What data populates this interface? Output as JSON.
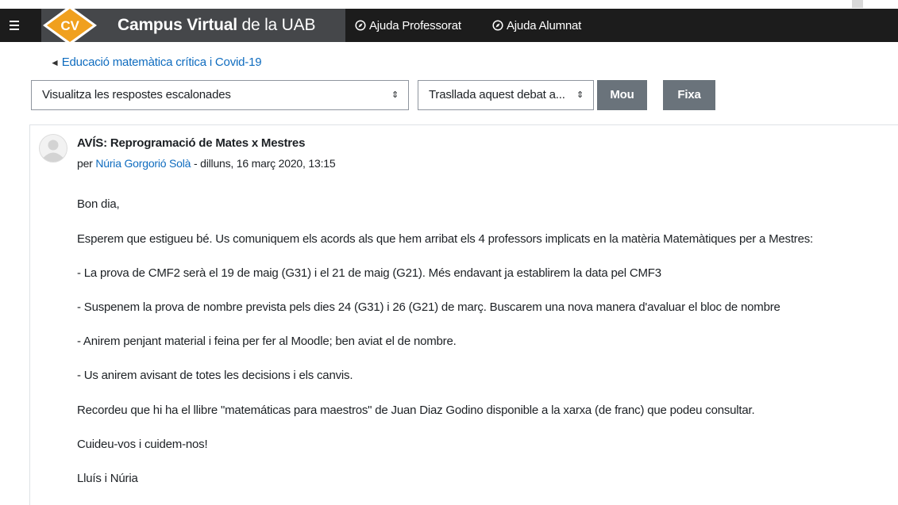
{
  "header": {
    "brand_bold": "Campus Virtual",
    "brand_rest": " de la UAB",
    "help_links": [
      "Ajuda Professorat",
      "Ajuda Alumnat"
    ]
  },
  "breadcrumb": {
    "back_label": "Educació matemàtica crítica i Covid-19"
  },
  "controls": {
    "display_mode": "Visualitza les respostes escalonades",
    "move_to": "Trasllada aquest debat a...",
    "move_button": "Mou",
    "pin_button": "Fixa"
  },
  "post": {
    "subject": "AVÍS: Reprogramació de Mates x Mestres",
    "by_prefix": "per",
    "author": "Núria Gorgorió Solà",
    "date": "- dilluns, 16 març 2020, 13:15",
    "paragraphs": [
      "Bon dia,",
      "Esperem que estigueu bé. Us comuniquem els  acords als que hem arribat els 4 professors implicats en la matèria Matemàtiques per a Mestres:",
      "- La prova de CMF2 serà el 19 de maig (G31)  i el 21 de maig (G21).  Més endavant ja establirem la data pel CMF3",
      "- Suspenem la prova de nombre prevista pels dies  24 (G31) i 26 (G21) de març. Buscarem una nova manera d'avaluar el bloc de nombre",
      "- Anirem penjant material i feina per fer al Moodle; ben aviat el de nombre.",
      "- Us anirem avisant de totes les decisions i els canvis.",
      "Recordeu que hi ha el llibre  \"matemáticas para maestros\" de Juan Diaz Godino disponible a la xarxa (de franc) que podeu consultar.",
      "Cuideu-vos i cuidem-nos!",
      "Lluís i Núria"
    ]
  },
  "colors": {
    "navbar": "#1c1c1c",
    "brand_block": "#45474a",
    "logo_orange": "#f0a01e",
    "link": "#0f6cbf",
    "button": "#6a737b"
  },
  "icons": [
    "menu-icon",
    "compass-icon",
    "user-avatar-icon",
    "sort-caret-icon"
  ]
}
